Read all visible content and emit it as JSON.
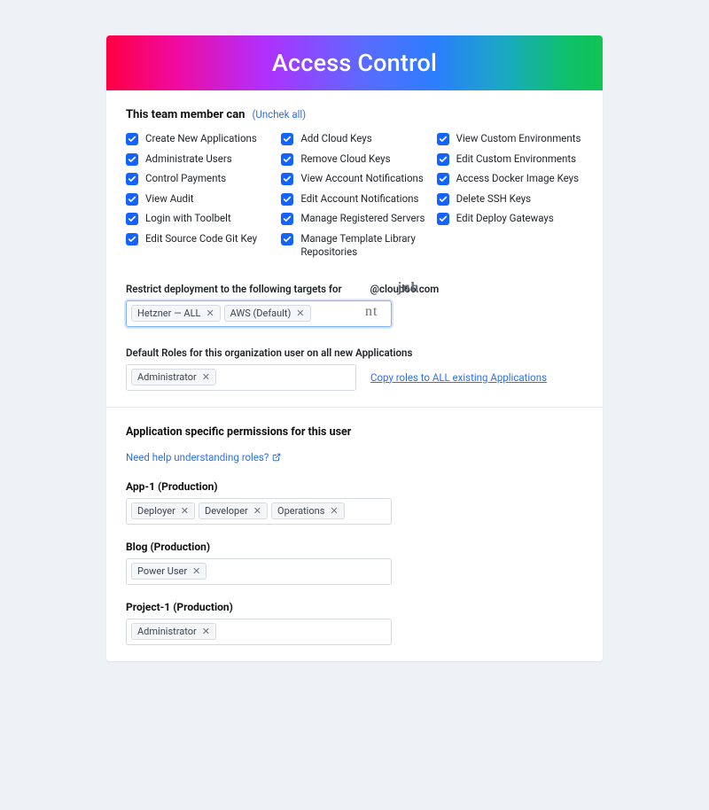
{
  "hero": {
    "title": "Access Control"
  },
  "perms": {
    "heading": "This team member can",
    "uncheck_all": "Unchek all",
    "col1": [
      "Create New Applications",
      "Administrate Users",
      "Control Payments",
      "View Audit",
      "Login with Toolbelt",
      "Edit Source Code Git Key"
    ],
    "col2": [
      "Add Cloud Keys",
      "Remove Cloud Keys",
      "View Account Notifications",
      "Edit Account Notifications",
      "Manage Registered Servers",
      "Manage Template Library Repositories"
    ],
    "col3": [
      "View Custom Environments",
      "Edit Custom Environments",
      "Access Docker Image Keys",
      "Delete SSH Keys",
      "Edit Deploy Gateways"
    ]
  },
  "restrict": {
    "label_prefix": "Restrict deployment to the following targets for",
    "label_suffix": "@cloud66.com",
    "overlay_joh": "joh",
    "overlay_nt": "nt",
    "tags": [
      "Hetzner — ALL",
      "AWS (Default)"
    ]
  },
  "default_roles": {
    "label": "Default Roles for this organization user on all new Applications",
    "tags": [
      "Administrator"
    ],
    "copy_link": "Copy roles to ALL existing Applications"
  },
  "app_perms": {
    "heading": "Application specific permissions for this user",
    "help": "Need help understanding roles?",
    "apps": [
      {
        "name": "App-1 (Production)",
        "roles": [
          "Deployer",
          "Developer",
          "Operations"
        ]
      },
      {
        "name": "Blog (Production)",
        "roles": [
          "Power User"
        ]
      },
      {
        "name": "Project-1 (Production)",
        "roles": [
          "Administrator"
        ]
      }
    ]
  }
}
